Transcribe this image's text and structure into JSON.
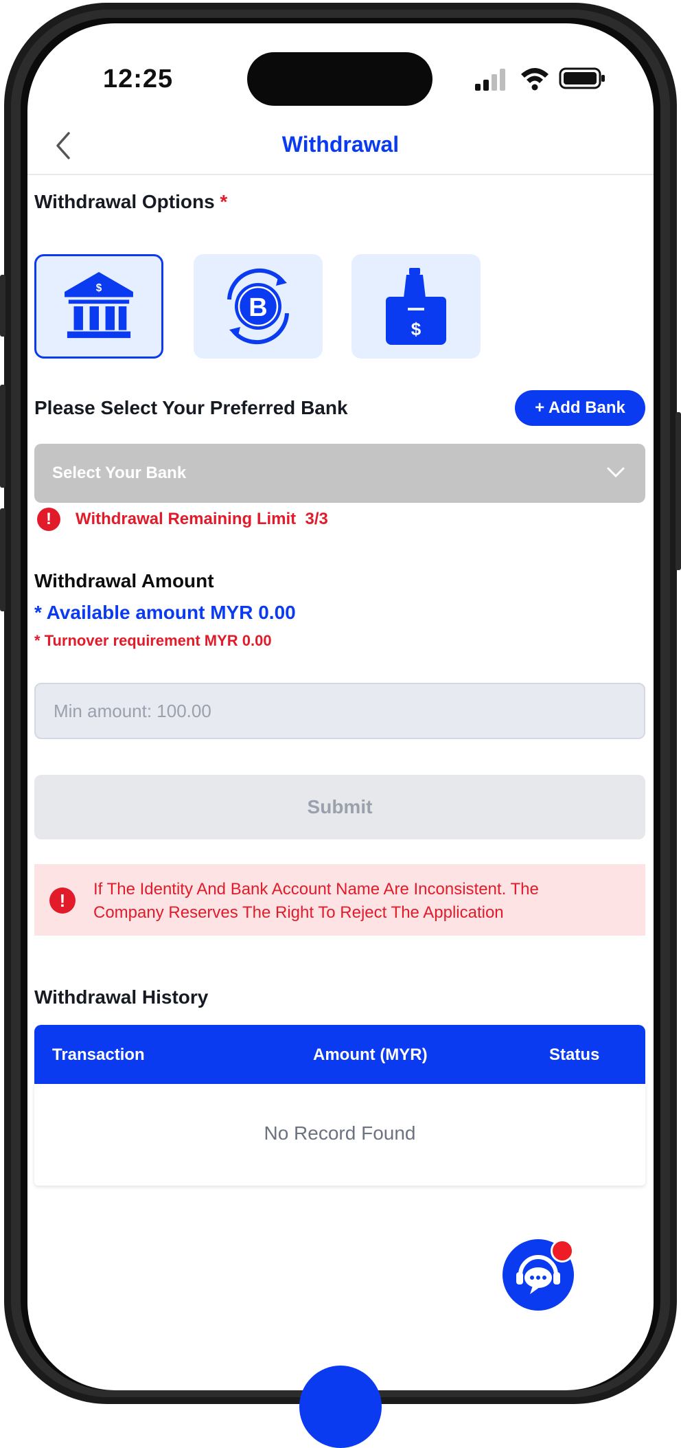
{
  "status_bar": {
    "time": "12:25"
  },
  "header": {
    "title": "Withdrawal",
    "back_icon": "chevron-left-icon"
  },
  "withdrawal_options": {
    "label": "Withdrawal Options",
    "required_mark": "*",
    "options": [
      {
        "icon": "bank-icon",
        "active": true
      },
      {
        "icon": "crypto-bitcoin-icon",
        "active": false
      },
      {
        "icon": "cash-box-icon",
        "active": false
      }
    ]
  },
  "bank": {
    "label": "Please Select Your Preferred Bank",
    "add_button": "+ Add Bank",
    "select_placeholder": "Select Your Bank",
    "limit_text": "Withdrawal Remaining Limit",
    "limit_value": "3/3"
  },
  "amount": {
    "title": "Withdrawal Amount",
    "available": "* Available amount MYR 0.00",
    "turnover_mark": "*",
    "turnover": "Turnover requirement MYR 0.00",
    "input_placeholder": "Min amount: 100.00"
  },
  "submit_label": "Submit",
  "notice": {
    "line1": "If The Identity And Bank Account Name Are Inconsistent. The",
    "line2": "Company Reserves The Right To Reject The Application"
  },
  "history": {
    "title": "Withdrawal History",
    "columns": [
      "Transaction",
      "Amount (MYR)",
      "Status"
    ],
    "empty_text": "No Record Found"
  },
  "colors": {
    "accent": "#0a3bf0",
    "danger": "#e21b2a",
    "notice_bg": "#fde3e4"
  }
}
